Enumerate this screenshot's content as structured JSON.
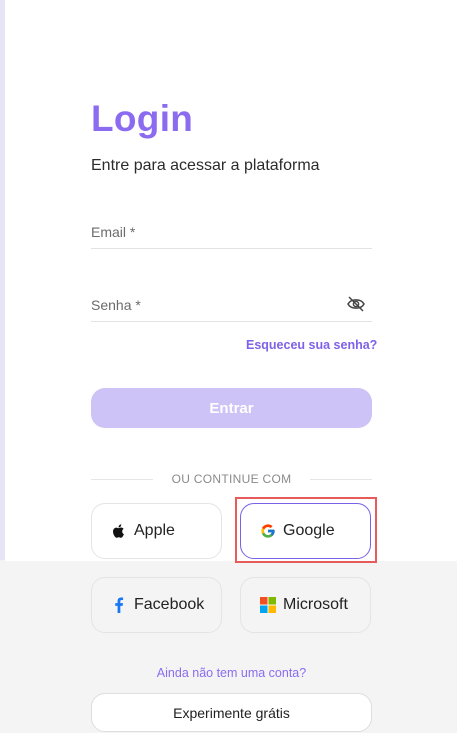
{
  "login": {
    "title": "Login",
    "subtitle": "Entre para acessar a plataforma",
    "email_label": "Email *",
    "password_label": "Senha *",
    "forgot_password": "Esqueceu sua senha?",
    "submit_label": "Entrar"
  },
  "social": {
    "divider_text": "OU CONTINUE COM",
    "apple": "Apple",
    "google": "Google",
    "facebook": "Facebook",
    "microsoft": "Microsoft"
  },
  "signup": {
    "prompt": "Ainda não tem uma conta?",
    "trial_label": "Experimente grátis"
  },
  "icons": {
    "password_toggle": "eye-off-icon",
    "apple": "apple-icon",
    "google": "google-icon",
    "facebook": "facebook-icon",
    "microsoft": "microsoft-icon"
  },
  "colors": {
    "brand": "#8b6cf0",
    "submit_disabled": "#cdc3f7",
    "highlight": "#e85b5b"
  }
}
